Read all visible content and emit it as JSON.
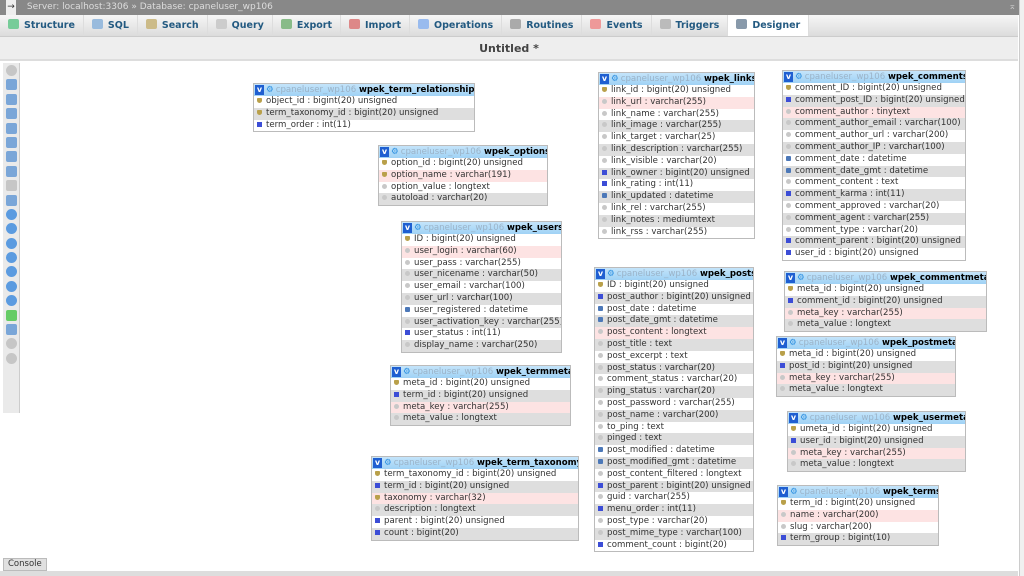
{
  "breadcrumb": {
    "server": "Server: localhost:3306",
    "separator": "»",
    "database": "Database: cpaneluser_wp106"
  },
  "tabs": [
    {
      "label": "Structure",
      "icon": "structure-icon",
      "color": "#7c9"
    },
    {
      "label": "SQL",
      "icon": "sql-icon",
      "color": "#9bd"
    },
    {
      "label": "Search",
      "icon": "search-icon",
      "color": "#cb8"
    },
    {
      "label": "Query",
      "icon": "query-icon",
      "color": "#ccc"
    },
    {
      "label": "Export",
      "icon": "export-icon",
      "color": "#8b8"
    },
    {
      "label": "Import",
      "icon": "import-icon",
      "color": "#d88"
    },
    {
      "label": "Operations",
      "icon": "wrench-icon",
      "color": "#9be"
    },
    {
      "label": "Routines",
      "icon": "routines-icon",
      "color": "#aaa"
    },
    {
      "label": "Events",
      "icon": "clock-icon",
      "color": "#e99"
    },
    {
      "label": "Triggers",
      "icon": "triggers-icon",
      "color": "#bbb"
    },
    {
      "label": "Designer",
      "icon": "designer-icon",
      "color": "#89a",
      "active": true
    }
  ],
  "title": "Untitled *",
  "console": "Console",
  "db": "cpaneluser_wp106",
  "tables": [
    {
      "name": "wpek_term_relationships",
      "cols": [
        [
          "object_id : bigint(20) unsigned",
          "key",
          0
        ],
        [
          "term_taxonomy_id : bigint(20) unsigned",
          "key",
          0
        ],
        [
          "term_order : int(11)",
          "int",
          0
        ]
      ]
    },
    {
      "name": "wpek_options",
      "cols": [
        [
          "option_id : bigint(20) unsigned",
          "key",
          0
        ],
        [
          "option_name : varchar(191)",
          "key",
          1
        ],
        [
          "option_value : longtext",
          "text",
          0
        ],
        [
          "autoload : varchar(20)",
          "text",
          0
        ]
      ]
    },
    {
      "name": "wpek_users",
      "cols": [
        [
          "ID : bigint(20) unsigned",
          "key",
          0
        ],
        [
          "user_login : varchar(60)",
          "text",
          1
        ],
        [
          "user_pass : varchar(255)",
          "text",
          0
        ],
        [
          "user_nicename : varchar(50)",
          "text",
          0
        ],
        [
          "user_email : varchar(100)",
          "text",
          0
        ],
        [
          "user_url : varchar(100)",
          "text",
          0
        ],
        [
          "user_registered : datetime",
          "date",
          0
        ],
        [
          "user_activation_key : varchar(255)",
          "text",
          0
        ],
        [
          "user_status : int(11)",
          "int",
          0
        ],
        [
          "display_name : varchar(250)",
          "text",
          0
        ]
      ]
    },
    {
      "name": "wpek_termmeta",
      "cols": [
        [
          "meta_id : bigint(20) unsigned",
          "key",
          0
        ],
        [
          "term_id : bigint(20) unsigned",
          "int",
          0
        ],
        [
          "meta_key : varchar(255)",
          "text",
          1
        ],
        [
          "meta_value : longtext",
          "text",
          0
        ]
      ]
    },
    {
      "name": "wpek_term_taxonomy",
      "cols": [
        [
          "term_taxonomy_id : bigint(20) unsigned",
          "key",
          0
        ],
        [
          "term_id : bigint(20) unsigned",
          "int",
          0
        ],
        [
          "taxonomy : varchar(32)",
          "key",
          1
        ],
        [
          "description : longtext",
          "text",
          0
        ],
        [
          "parent : bigint(20) unsigned",
          "int",
          0
        ],
        [
          "count : bigint(20)",
          "int",
          0
        ]
      ]
    },
    {
      "name": "wpek_links",
      "cols": [
        [
          "link_id : bigint(20) unsigned",
          "key",
          0
        ],
        [
          "link_url : varchar(255)",
          "text",
          1
        ],
        [
          "link_name : varchar(255)",
          "text",
          0
        ],
        [
          "link_image : varchar(255)",
          "text",
          0
        ],
        [
          "link_target : varchar(25)",
          "text",
          0
        ],
        [
          "link_description : varchar(255)",
          "text",
          0
        ],
        [
          "link_visible : varchar(20)",
          "text",
          0
        ],
        [
          "link_owner : bigint(20) unsigned",
          "int",
          0
        ],
        [
          "link_rating : int(11)",
          "int",
          0
        ],
        [
          "link_updated : datetime",
          "date",
          0
        ],
        [
          "link_rel : varchar(255)",
          "text",
          0
        ],
        [
          "link_notes : mediumtext",
          "text",
          0
        ],
        [
          "link_rss : varchar(255)",
          "text",
          0
        ]
      ]
    },
    {
      "name": "wpek_posts",
      "cols": [
        [
          "ID : bigint(20) unsigned",
          "key",
          0
        ],
        [
          "post_author : bigint(20) unsigned",
          "int",
          0
        ],
        [
          "post_date : datetime",
          "date",
          0
        ],
        [
          "post_date_gmt : datetime",
          "date",
          0
        ],
        [
          "post_content : longtext",
          "text",
          1
        ],
        [
          "post_title : text",
          "text",
          0
        ],
        [
          "post_excerpt : text",
          "text",
          0
        ],
        [
          "post_status : varchar(20)",
          "text",
          0
        ],
        [
          "comment_status : varchar(20)",
          "text",
          0
        ],
        [
          "ping_status : varchar(20)",
          "text",
          0
        ],
        [
          "post_password : varchar(255)",
          "text",
          0
        ],
        [
          "post_name : varchar(200)",
          "text",
          0
        ],
        [
          "to_ping : text",
          "text",
          0
        ],
        [
          "pinged : text",
          "text",
          0
        ],
        [
          "post_modified : datetime",
          "date",
          0
        ],
        [
          "post_modified_gmt : datetime",
          "date",
          0
        ],
        [
          "post_content_filtered : longtext",
          "text",
          0
        ],
        [
          "post_parent : bigint(20) unsigned",
          "int",
          0
        ],
        [
          "guid : varchar(255)",
          "text",
          0
        ],
        [
          "menu_order : int(11)",
          "int",
          0
        ],
        [
          "post_type : varchar(20)",
          "text",
          0
        ],
        [
          "post_mime_type : varchar(100)",
          "text",
          0
        ],
        [
          "comment_count : bigint(20)",
          "int",
          0
        ]
      ]
    },
    {
      "name": "wpek_comments",
      "cols": [
        [
          "comment_ID : bigint(20) unsigned",
          "key",
          0
        ],
        [
          "comment_post_ID : bigint(20) unsigned",
          "int",
          0
        ],
        [
          "comment_author : tinytext",
          "text",
          1
        ],
        [
          "comment_author_email : varchar(100)",
          "text",
          0
        ],
        [
          "comment_author_url : varchar(200)",
          "text",
          0
        ],
        [
          "comment_author_IP : varchar(100)",
          "text",
          0
        ],
        [
          "comment_date : datetime",
          "date",
          0
        ],
        [
          "comment_date_gmt : datetime",
          "date",
          0
        ],
        [
          "comment_content : text",
          "text",
          0
        ],
        [
          "comment_karma : int(11)",
          "int",
          0
        ],
        [
          "comment_approved : varchar(20)",
          "text",
          0
        ],
        [
          "comment_agent : varchar(255)",
          "text",
          0
        ],
        [
          "comment_type : varchar(20)",
          "text",
          0
        ],
        [
          "comment_parent : bigint(20) unsigned",
          "int",
          0
        ],
        [
          "user_id : bigint(20) unsigned",
          "int",
          0
        ]
      ]
    },
    {
      "name": "wpek_commentmeta",
      "cols": [
        [
          "meta_id : bigint(20) unsigned",
          "key",
          0
        ],
        [
          "comment_id : bigint(20) unsigned",
          "int",
          0
        ],
        [
          "meta_key : varchar(255)",
          "text",
          1
        ],
        [
          "meta_value : longtext",
          "text",
          0
        ]
      ]
    },
    {
      "name": "wpek_postmeta",
      "cols": [
        [
          "meta_id : bigint(20) unsigned",
          "key",
          0
        ],
        [
          "post_id : bigint(20) unsigned",
          "int",
          0
        ],
        [
          "meta_key : varchar(255)",
          "text",
          1
        ],
        [
          "meta_value : longtext",
          "text",
          0
        ]
      ]
    },
    {
      "name": "wpek_usermeta",
      "cols": [
        [
          "umeta_id : bigint(20) unsigned",
          "key",
          0
        ],
        [
          "user_id : bigint(20) unsigned",
          "int",
          0
        ],
        [
          "meta_key : varchar(255)",
          "text",
          1
        ],
        [
          "meta_value : longtext",
          "text",
          0
        ]
      ]
    },
    {
      "name": "wpek_terms",
      "cols": [
        [
          "term_id : bigint(20) unsigned",
          "key",
          0
        ],
        [
          "name : varchar(200)",
          "text",
          1
        ],
        [
          "slug : varchar(200)",
          "text",
          0
        ],
        [
          "term_group : bigint(10)",
          "int",
          0
        ]
      ]
    }
  ]
}
